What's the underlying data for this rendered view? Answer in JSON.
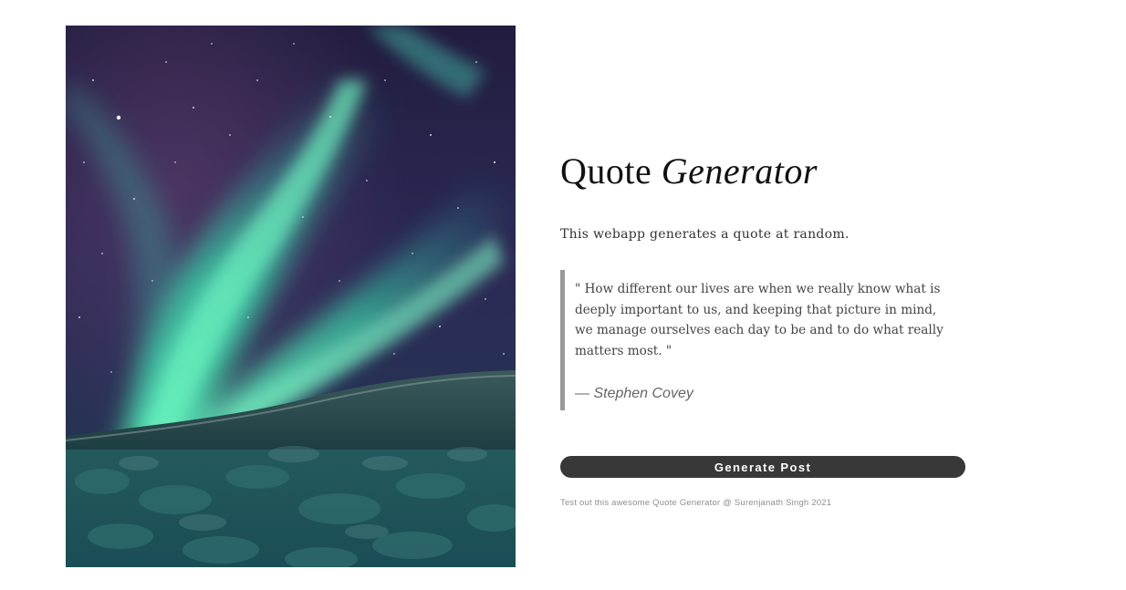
{
  "hero": {
    "image": "aurora-borealis-over-snowy-forest",
    "colors": {
      "sky": "#1f2147",
      "aurora": "#3df0b5",
      "forest": "#1d4f52"
    }
  },
  "header": {
    "title_plain": "Quote",
    "title_italic": "Generator"
  },
  "intro": {
    "text": "This webapp generates a quote at random."
  },
  "quote": {
    "text": "\" How different our lives are when we really know what is deeply important to us, and keeping that picture in mind, we manage ourselves each day to be and to do what really matters most. \"",
    "author": "— Stephen Covey"
  },
  "actions": {
    "generate_label": "Generate Post"
  },
  "footer": {
    "text": "Test out this awesome Quote Generator @ Surenjanath Singh 2021"
  }
}
